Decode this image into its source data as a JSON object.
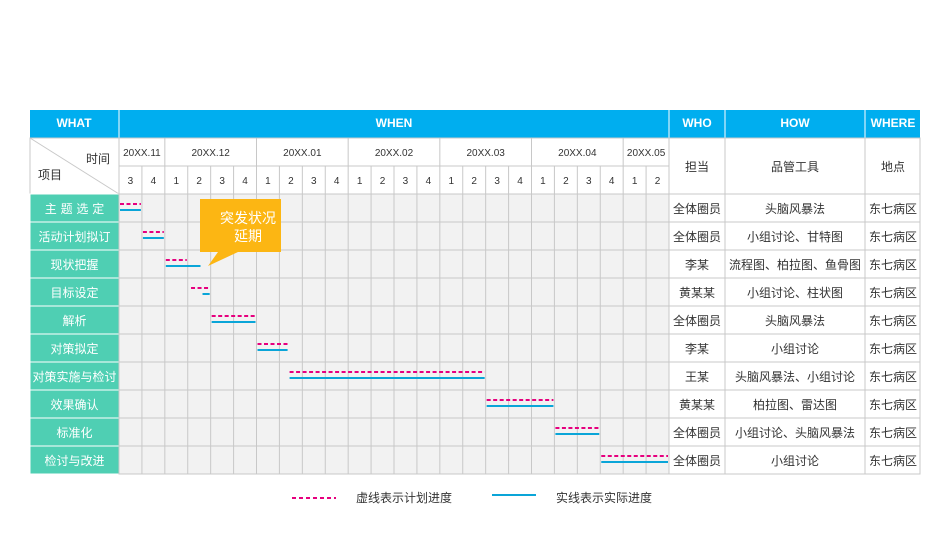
{
  "headers": {
    "what": "WHAT",
    "when": "WHEN",
    "who": "WHO",
    "how": "HOW",
    "where": "WHERE"
  },
  "sub_headers": {
    "time": "时间",
    "item": "项目",
    "owner": "担当",
    "tool": "品管工具",
    "place": "地点"
  },
  "callout": {
    "line1": "突发状况",
    "line2": "延期"
  },
  "legend": {
    "plan_label": "虚线表示计划进度",
    "actual_label": "实线表示实际进度"
  },
  "colors": {
    "header": "#00aeef",
    "task": "#4fcfb3",
    "plan": "#e6007e",
    "actual": "#0aa5d8",
    "callout": "#fcb613",
    "grid": "#c8c8c8",
    "cell": "#f2f2f2"
  },
  "chart_data": {
    "type": "gantt",
    "months": [
      {
        "label": "20XX.11",
        "weeks": [
          "3",
          "4"
        ]
      },
      {
        "label": "20XX.12",
        "weeks": [
          "1",
          "2",
          "3",
          "4"
        ]
      },
      {
        "label": "20XX.01",
        "weeks": [
          "1",
          "2",
          "3",
          "4"
        ]
      },
      {
        "label": "20XX.02",
        "weeks": [
          "1",
          "2",
          "3",
          "4"
        ]
      },
      {
        "label": "20XX.03",
        "weeks": [
          "1",
          "2",
          "3",
          "4"
        ]
      },
      {
        "label": "20XX.04",
        "weeks": [
          "1",
          "2",
          "3",
          "4"
        ]
      },
      {
        "label": "20XX.05",
        "weeks": [
          "1",
          "2"
        ]
      }
    ],
    "tasks": [
      {
        "name": "主 题 选 定",
        "owner": "全体圈员",
        "tool": "头脑风暴法",
        "place": "东七病区",
        "plan": [
          0,
          1
        ],
        "actual": [
          0,
          1
        ]
      },
      {
        "name": "活动计划拟订",
        "owner": "全体圈员",
        "tool": "小组讨论、甘特图",
        "place": "东七病区",
        "plan": [
          1,
          2
        ],
        "actual": [
          1,
          2
        ]
      },
      {
        "name": "现状把握",
        "owner": "李某",
        "tool": "流程图、柏拉图、鱼骨图",
        "place": "东七病区",
        "plan": [
          2,
          3
        ],
        "actual": [
          2,
          3.6
        ]
      },
      {
        "name": "目标设定",
        "owner": "黄某某",
        "tool": "小组讨论、柱状图",
        "place": "东七病区",
        "plan": [
          3.1,
          4
        ],
        "actual": [
          3.6,
          4
        ]
      },
      {
        "name": "解析",
        "owner": "全体圈员",
        "tool": "头脑风暴法",
        "place": "东七病区",
        "plan": [
          4,
          6
        ],
        "actual": [
          4,
          6
        ]
      },
      {
        "name": "对策拟定",
        "owner": "李某",
        "tool": "小组讨论",
        "place": "东七病区",
        "plan": [
          6,
          7.4
        ],
        "actual": [
          6,
          7.4
        ]
      },
      {
        "name": "对策实施与检讨",
        "owner": "王某",
        "tool": "头脑风暴法、小组讨论",
        "place": "东七病区",
        "plan": [
          7.4,
          16
        ],
        "actual": [
          7.4,
          16
        ]
      },
      {
        "name": "效果确认",
        "owner": "黄某某",
        "tool": "柏拉图、雷达图",
        "place": "东七病区",
        "plan": [
          16,
          19
        ],
        "actual": [
          16,
          19
        ]
      },
      {
        "name": "标准化",
        "owner": "全体圈员",
        "tool": "小组讨论、头脑风暴法",
        "place": "东七病区",
        "plan": [
          19,
          21
        ],
        "actual": [
          19,
          21
        ]
      },
      {
        "name": "检讨与改进",
        "owner": "全体圈员",
        "tool": "小组讨论",
        "place": "东七病区",
        "plan": [
          21,
          24
        ],
        "actual": [
          21,
          24
        ]
      }
    ]
  }
}
